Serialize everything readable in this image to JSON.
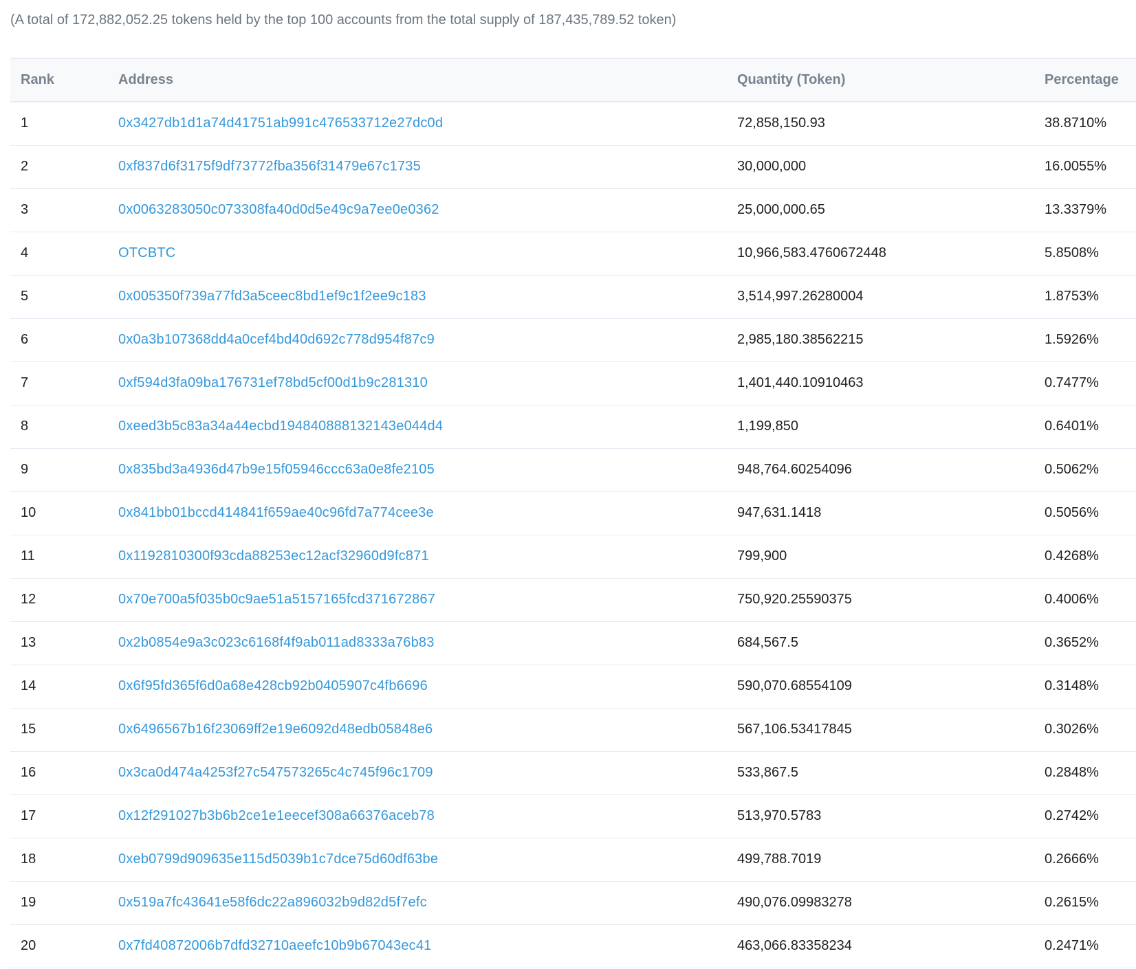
{
  "summary": "(A total of 172,882,052.25 tokens held by the top 100 accounts from the total supply of 187,435,789.52 token)",
  "table": {
    "headers": {
      "rank": "Rank",
      "address": "Address",
      "quantity": "Quantity (Token)",
      "percentage": "Percentage"
    },
    "rows": [
      {
        "rank": "1",
        "address": "0x3427db1d1a74d41751ab991c476533712e27dc0d",
        "quantity": "72,858,150.93",
        "percentage": "38.8710%"
      },
      {
        "rank": "2",
        "address": "0xf837d6f3175f9df73772fba356f31479e67c1735",
        "quantity": "30,000,000",
        "percentage": "16.0055%"
      },
      {
        "rank": "3",
        "address": "0x0063283050c073308fa40d0d5e49c9a7ee0e0362",
        "quantity": "25,000,000.65",
        "percentage": "13.3379%"
      },
      {
        "rank": "4",
        "address": "OTCBTC",
        "quantity": "10,966,583.4760672448",
        "percentage": "5.8508%"
      },
      {
        "rank": "5",
        "address": "0x005350f739a77fd3a5ceec8bd1ef9c1f2ee9c183",
        "quantity": "3,514,997.26280004",
        "percentage": "1.8753%"
      },
      {
        "rank": "6",
        "address": "0x0a3b107368dd4a0cef4bd40d692c778d954f87c9",
        "quantity": "2,985,180.38562215",
        "percentage": "1.5926%"
      },
      {
        "rank": "7",
        "address": "0xf594d3fa09ba176731ef78bd5cf00d1b9c281310",
        "quantity": "1,401,440.10910463",
        "percentage": "0.7477%"
      },
      {
        "rank": "8",
        "address": "0xeed3b5c83a34a44ecbd194840888132143e044d4",
        "quantity": "1,199,850",
        "percentage": "0.6401%"
      },
      {
        "rank": "9",
        "address": "0x835bd3a4936d47b9e15f05946ccc63a0e8fe2105",
        "quantity": "948,764.60254096",
        "percentage": "0.5062%"
      },
      {
        "rank": "10",
        "address": "0x841bb01bccd414841f659ae40c96fd7a774cee3e",
        "quantity": "947,631.1418",
        "percentage": "0.5056%"
      },
      {
        "rank": "11",
        "address": "0x1192810300f93cda88253ec12acf32960d9fc871",
        "quantity": "799,900",
        "percentage": "0.4268%"
      },
      {
        "rank": "12",
        "address": "0x70e700a5f035b0c9ae51a5157165fcd371672867",
        "quantity": "750,920.25590375",
        "percentage": "0.4006%"
      },
      {
        "rank": "13",
        "address": "0x2b0854e9a3c023c6168f4f9ab011ad8333a76b83",
        "quantity": "684,567.5",
        "percentage": "0.3652%"
      },
      {
        "rank": "14",
        "address": "0x6f95fd365f6d0a68e428cb92b0405907c4fb6696",
        "quantity": "590,070.68554109",
        "percentage": "0.3148%"
      },
      {
        "rank": "15",
        "address": "0x6496567b16f23069ff2e19e6092d48edb05848e6",
        "quantity": "567,106.53417845",
        "percentage": "0.3026%"
      },
      {
        "rank": "16",
        "address": "0x3ca0d474a4253f27c547573265c4c745f96c1709",
        "quantity": "533,867.5",
        "percentage": "0.2848%"
      },
      {
        "rank": "17",
        "address": "0x12f291027b3b6b2ce1e1eecef308a66376aceb78",
        "quantity": "513,970.5783",
        "percentage": "0.2742%"
      },
      {
        "rank": "18",
        "address": "0xeb0799d909635e115d5039b1c7dce75d60df63be",
        "quantity": "499,788.7019",
        "percentage": "0.2666%"
      },
      {
        "rank": "19",
        "address": "0x519a7fc43641e58f6dc22a896032b9d82d5f7efc",
        "quantity": "490,076.09983278",
        "percentage": "0.2615%"
      },
      {
        "rank": "20",
        "address": "0x7fd40872006b7dfd32710aeefc10b9b67043ec41",
        "quantity": "463,066.83358234",
        "percentage": "0.2471%"
      }
    ]
  }
}
